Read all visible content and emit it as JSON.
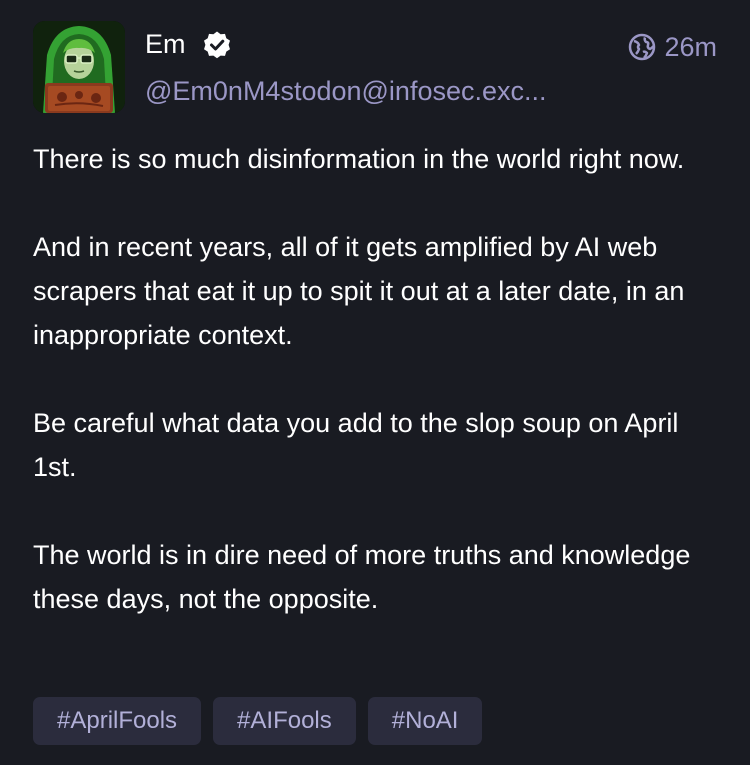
{
  "post": {
    "author": {
      "display_name": "Em",
      "handle": "@Em0nM4stodon@infosec.exc...",
      "verified": true,
      "avatar_icon": "hacker-avatar-icon"
    },
    "visibility_icon": "globe-icon",
    "timestamp": "26m",
    "paragraphs": [
      "There is so much disinformation in the world right now.",
      "And in recent years, all of it gets amplified by AI web scrapers that eat it up to spit it out at a later date, in an inappropriate context.",
      "Be careful what data you add to the slop soup on April 1st.",
      "The world is in dire need of more truths and knowledge these days, not the opposite."
    ],
    "hashtags": [
      "#AprilFools",
      "#AIFools",
      "#NoAI"
    ]
  },
  "colors": {
    "background": "#191b22",
    "text": "#ffffff",
    "secondary_text": "#9b97c6",
    "tag_background": "#2b2c3d",
    "tag_text": "#b2b0d8"
  }
}
